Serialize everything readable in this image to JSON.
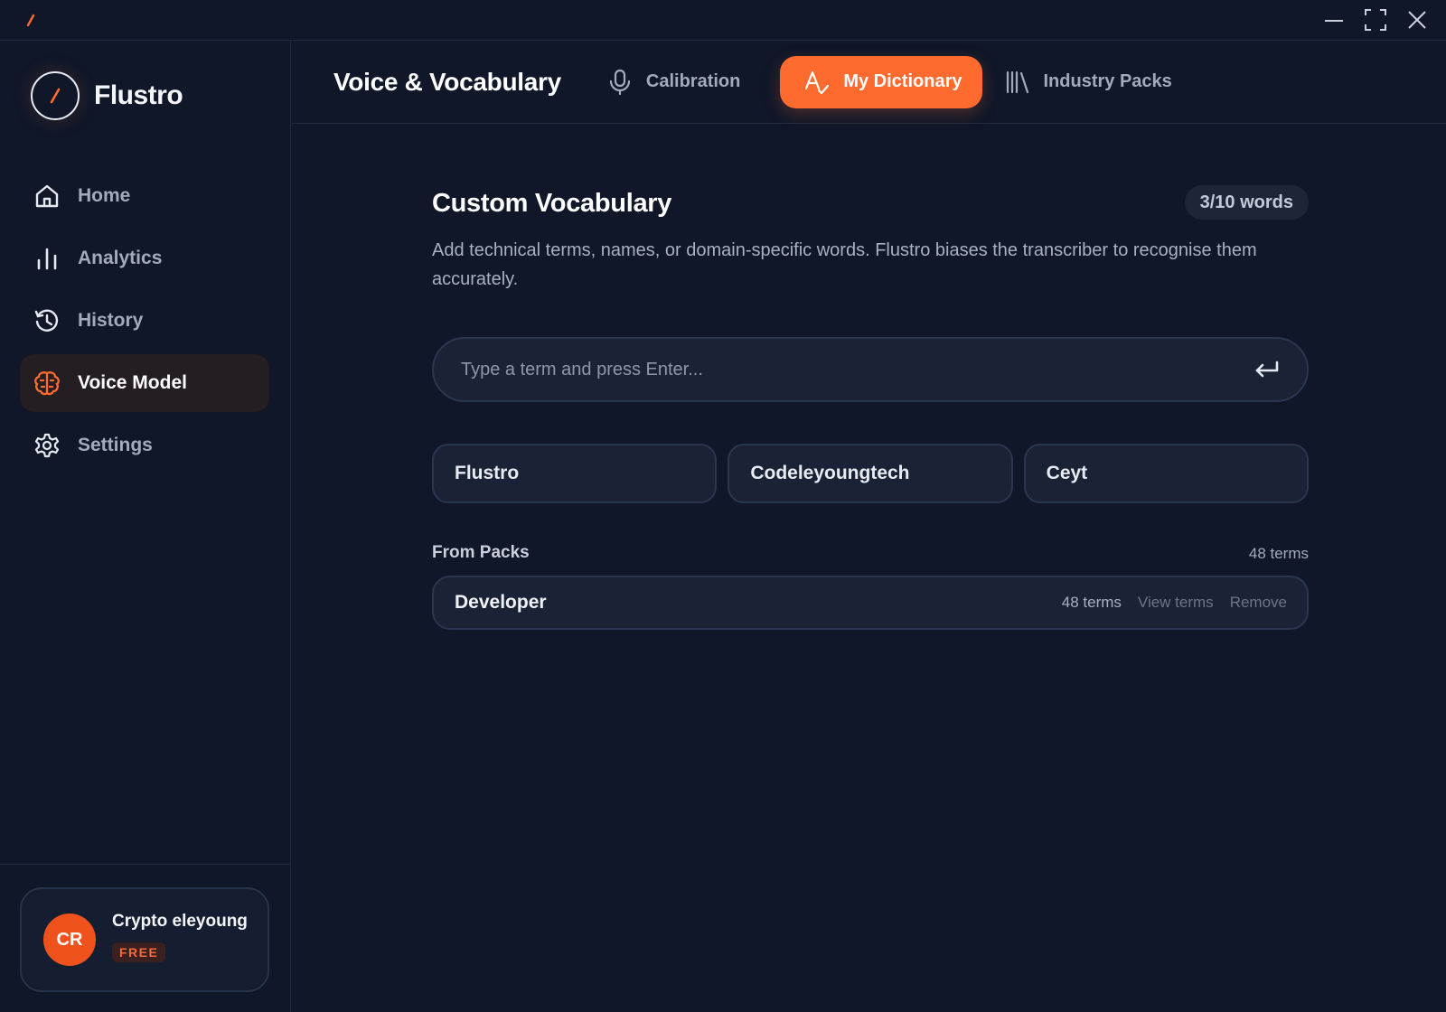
{
  "window": {
    "controls": [
      "minimize-icon",
      "maximize-icon",
      "close-icon"
    ]
  },
  "sidebar": {
    "brand_name": "Flustro",
    "items": [
      {
        "label": "Home",
        "icon": "home-icon",
        "active": false
      },
      {
        "label": "Analytics",
        "icon": "bar-chart-icon",
        "active": false
      },
      {
        "label": "History",
        "icon": "history-icon",
        "active": false
      },
      {
        "label": "Voice Model",
        "icon": "brain-icon",
        "active": true
      },
      {
        "label": "Settings",
        "icon": "gear-icon",
        "active": false
      }
    ],
    "user": {
      "initials": "CR",
      "name": "Crypto eleyoung",
      "plan": "FREE"
    }
  },
  "header": {
    "title": "Voice & Vocabulary",
    "tabs": [
      {
        "label": "Calibration",
        "icon": "microphone-icon",
        "active": false
      },
      {
        "label": "My Dictionary",
        "icon": "spellcheck-icon",
        "active": true
      },
      {
        "label": "Industry Packs",
        "icon": "library-icon",
        "active": false
      }
    ]
  },
  "main": {
    "section_title": "Custom Vocabulary",
    "word_count": "3/10 words",
    "description": "Add technical terms, names, or domain-specific words. Flustro biases the transcriber to recognise them accurately.",
    "input_placeholder": "Type a term and press Enter...",
    "input_value": "",
    "terms": [
      "Flustro",
      "Codeleyoungtech",
      "Ceyt"
    ],
    "from_packs": {
      "title": "From Packs",
      "count": "48 terms",
      "packs": [
        {
          "name": "Developer",
          "terms": "48 terms",
          "view_label": "View terms",
          "remove_label": "Remove"
        }
      ]
    }
  },
  "colors": {
    "background": "#0f1729",
    "accent": "#ff6a2e",
    "active_nav_bg": "#241d22",
    "avatar": "#f0521e"
  }
}
